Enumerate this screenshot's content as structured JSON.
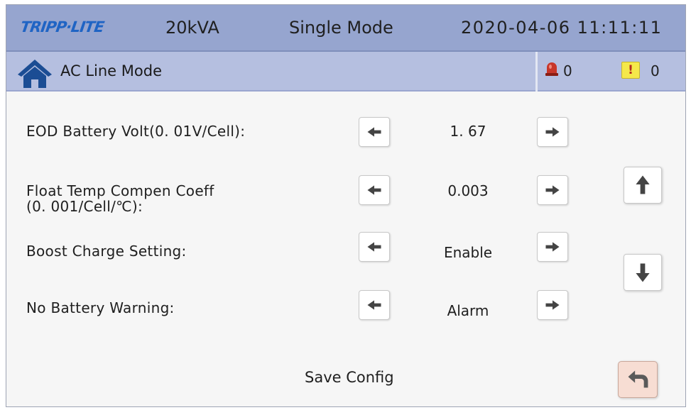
{
  "header": {
    "brand": "TRIPP·LITE",
    "model": "20kVA",
    "system_mode": "Single Mode",
    "datetime": "2020-04-06 11:11:11"
  },
  "status": {
    "mode_label": "AC Line Mode",
    "alarm_count": "0",
    "warning_count": "0",
    "warning_symbol": "!"
  },
  "settings": [
    {
      "label": "EOD Battery Volt(0. 01V/Cell):",
      "value": "1. 67"
    },
    {
      "label": "Float Temp Compen Coeff",
      "label_sub": "(0. 001/Cell/℃):",
      "value": "0.003"
    },
    {
      "label": "Boost Charge Setting:",
      "value": "Enable"
    },
    {
      "label": "No Battery Warning:",
      "value": "Alarm"
    }
  ],
  "footer": {
    "save_label": "Save Config"
  },
  "colors": {
    "header_bg": "#96a5cf",
    "status_bg": "#b5bfe0",
    "brand": "#1f64c4",
    "back_button_bg": "#f7ddd3",
    "warning_yellow": "#f5e84a",
    "alarm_red": "#c8362a"
  },
  "icons": {
    "home": "home-icon",
    "alarm": "alarm-bell-icon",
    "warning": "warning-icon",
    "left": "arrow-left-icon",
    "right": "arrow-right-icon",
    "up": "arrow-up-icon",
    "down": "arrow-down-icon",
    "back": "return-icon"
  }
}
